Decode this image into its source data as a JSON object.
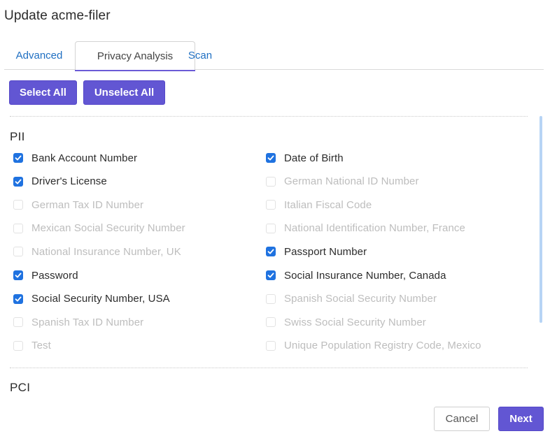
{
  "dialog": {
    "title": "Update acme-filer"
  },
  "tabs": [
    {
      "label": "Advanced",
      "active": false
    },
    {
      "label": "Privacy Analysis",
      "active": true
    },
    {
      "label": "Scan",
      "active": false
    }
  ],
  "actions": {
    "select_all": "Select All",
    "unselect_all": "Unselect All"
  },
  "sections": {
    "pii": {
      "title": "PII",
      "left": [
        {
          "label": "Bank Account Number",
          "checked": true
        },
        {
          "label": "Driver's License",
          "checked": true
        },
        {
          "label": "German Tax ID Number",
          "checked": false
        },
        {
          "label": "Mexican Social Security Number",
          "checked": false
        },
        {
          "label": "National Insurance Number, UK",
          "checked": false
        },
        {
          "label": "Password",
          "checked": true
        },
        {
          "label": "Social Security Number, USA",
          "checked": true
        },
        {
          "label": "Spanish Tax ID Number",
          "checked": false
        },
        {
          "label": "Test",
          "checked": false
        }
      ],
      "right": [
        {
          "label": "Date of Birth",
          "checked": true
        },
        {
          "label": "German National ID Number",
          "checked": false
        },
        {
          "label": "Italian Fiscal Code",
          "checked": false
        },
        {
          "label": "National Identification Number, France",
          "checked": false
        },
        {
          "label": "Passport Number",
          "checked": true
        },
        {
          "label": "Social Insurance Number, Canada",
          "checked": true
        },
        {
          "label": "Spanish Social Security Number",
          "checked": false
        },
        {
          "label": "Swiss Social Security Number",
          "checked": false
        },
        {
          "label": "Unique Population Registry Code, Mexico",
          "checked": false
        }
      ]
    },
    "pci": {
      "title": "PCI"
    }
  },
  "footer": {
    "cancel": "Cancel",
    "next": "Next"
  },
  "colors": {
    "accent": "#6256d3",
    "checkbox": "#1f72e0",
    "link": "#1f6fc2"
  }
}
